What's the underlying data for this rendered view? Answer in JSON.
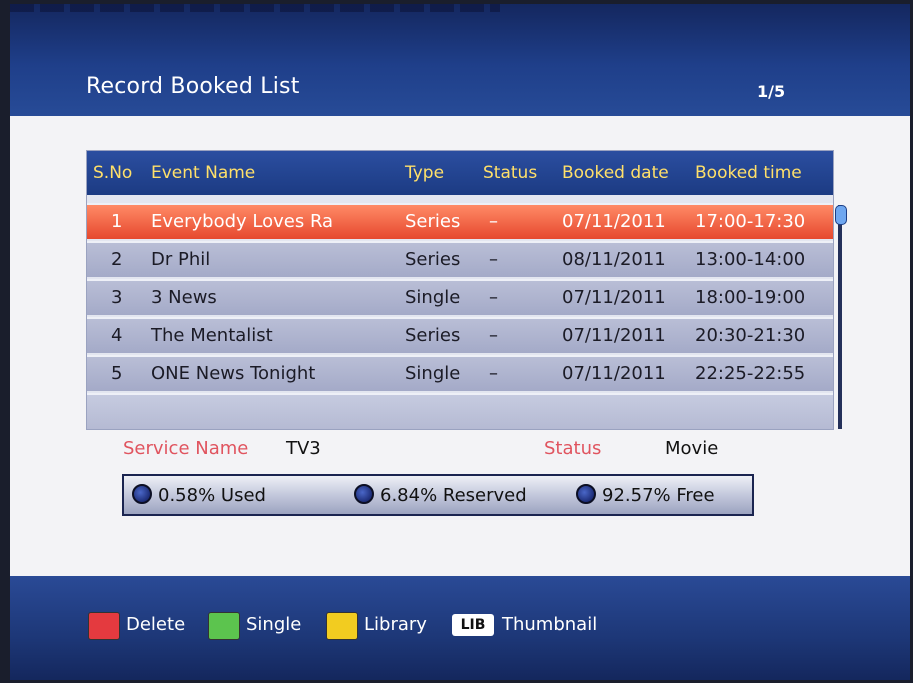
{
  "header": {
    "title": "Record Booked List",
    "page": "1/5"
  },
  "table": {
    "columns": [
      "S.No",
      "Event Name",
      "Type",
      "Status",
      "Booked date",
      "Booked time"
    ],
    "rows": [
      {
        "sno": "1",
        "event": "Everybody Loves Ra",
        "type": "Series",
        "status": "–",
        "date": "07/11/2011",
        "time": "17:00-17:30"
      },
      {
        "sno": "2",
        "event": "Dr Phil",
        "type": "Series",
        "status": "–",
        "date": "08/11/2011",
        "time": "13:00-14:00"
      },
      {
        "sno": "3",
        "event": "3 News",
        "type": "Single",
        "status": "–",
        "date": "07/11/2011",
        "time": "18:00-19:00"
      },
      {
        "sno": "4",
        "event": "The Mentalist",
        "type": "Series",
        "status": "–",
        "date": "07/11/2011",
        "time": "20:30-21:30"
      },
      {
        "sno": "5",
        "event": "ONE News Tonight",
        "type": "Single",
        "status": "–",
        "date": "07/11/2011",
        "time": "22:25-22:55"
      }
    ],
    "selected_index": 0
  },
  "info": {
    "service_label": "Service Name",
    "service_value": "TV3",
    "status_label": "Status",
    "status_value": "Movie"
  },
  "usage": {
    "used": "0.58% Used",
    "reserved": "6.84% Reserved",
    "free": "92.57% Free"
  },
  "footer": {
    "keys": [
      {
        "label": "Delete",
        "color": "#e43a3f",
        "icon": "red-key-icon"
      },
      {
        "label": "Single",
        "color": "#5cc44e",
        "icon": "green-key-icon"
      },
      {
        "label": "Library",
        "color": "#f2cc20",
        "icon": "yellow-key-icon"
      },
      {
        "badge": "LIB",
        "label": "Thumbnail",
        "icon": "lib-key-icon"
      }
    ]
  },
  "colors": {
    "header_text": "#ffe06a",
    "selected_row": "#e6482e",
    "label_red": "#e0545f"
  }
}
